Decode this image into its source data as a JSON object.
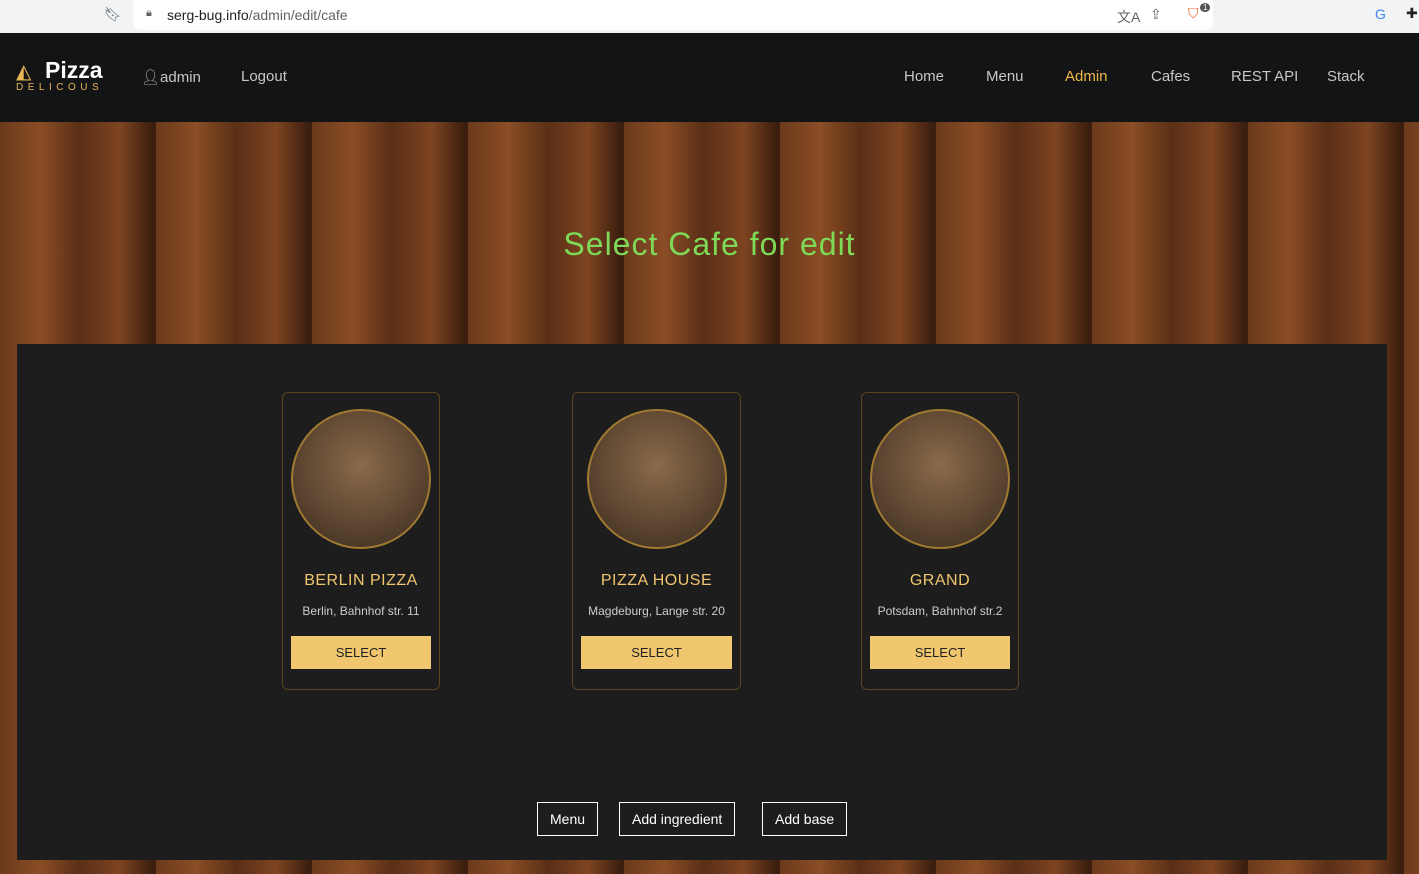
{
  "browser": {
    "url_host": "serg-bug.info",
    "url_path": "/admin/edit/cafe",
    "extension_badge": "1"
  },
  "nav": {
    "logo_title": "Pizza",
    "logo_sub": "DELICOUS",
    "user": "admin",
    "logout": "Logout",
    "links": [
      "Home",
      "Menu",
      "Admin",
      "Cafes",
      "REST API",
      "Stack"
    ],
    "active": "Admin"
  },
  "page": {
    "title": "Select Cafe for edit"
  },
  "cafes": [
    {
      "name": "BERLIN PIZZA",
      "address": "Berlin, Bahnhof str. 11",
      "button": "SELECT"
    },
    {
      "name": "PIZZA HOUSE",
      "address": "Magdeburg, Lange str. 20",
      "button": "SELECT"
    },
    {
      "name": "GRAND",
      "address": "Potsdam, Bahnhof str.2",
      "button": "SELECT"
    }
  ],
  "actions": {
    "menu": "Menu",
    "add_ingredient": "Add ingredient",
    "add_base": "Add base"
  }
}
